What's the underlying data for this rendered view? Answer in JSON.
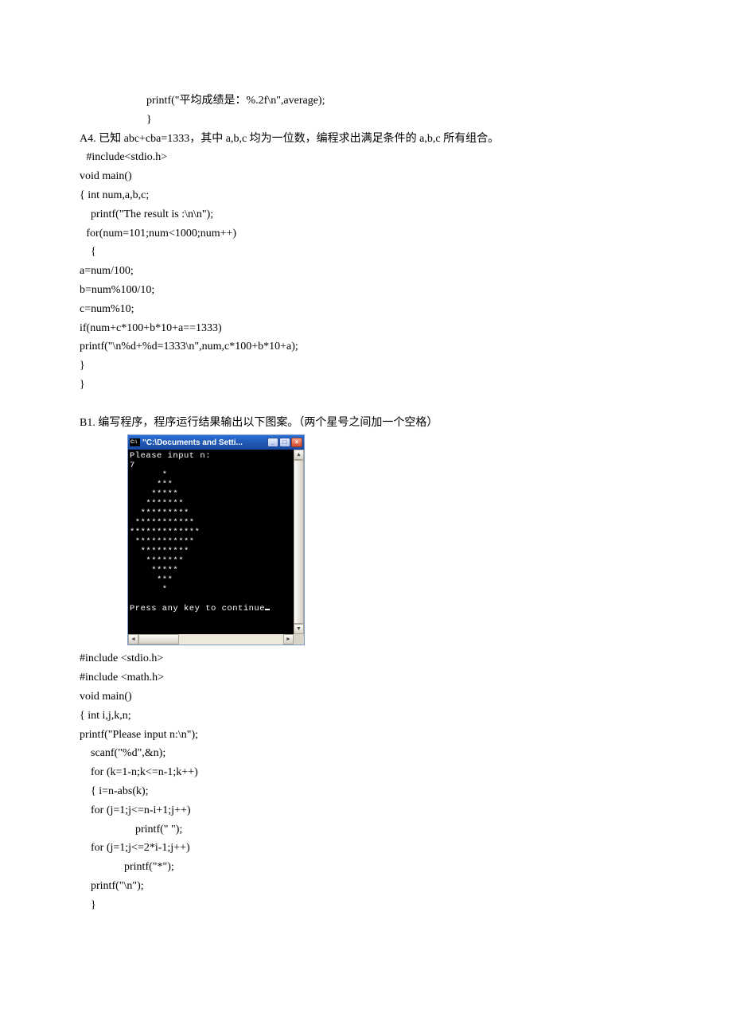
{
  "sec0": {
    "l1": "printf(\"平均成绩是：%.2f\\n\",average);",
    "l2": "}"
  },
  "a4": {
    "title": "A4.  已知 abc+cba=1333，其中 a,b,c 均为一位数，编程求出满足条件的 a,b,c 所有组合。",
    "l1": "#include<stdio.h>",
    "l2": "void main()",
    "l3": "{    int num,a,b,c;",
    "l4": "printf(\"The result is :\\n\\n\");",
    "l5": "for(num=101;num<1000;num++)",
    "l6": "{",
    "l7": "a=num/100;",
    "l8": "b=num%100/10;",
    "l9": "c=num%10;",
    "l10": "if(num+c*100+b*10+a==1333)",
    "l11": "printf(\"\\n%d+%d=1333\\n\",num,c*100+b*10+a);",
    "l12": "}",
    "l13": "}"
  },
  "b1": {
    "title": "B1.  编写程序，程序运行结果输出以下图案。（两个星号之间加一个空格）",
    "console": {
      "win_title": "\"C:\\Documents and Setti...",
      "output": "Please input n:\n7\n      *\n     ***\n    *****\n   *******\n  *********\n ***********\n*************\n ***********\n  *********\n   *******\n    *****\n     ***\n      *\n\nPress any key to continue"
    },
    "code": {
      "l1": "#include <stdio.h>",
      "l2": "#include <math.h>",
      "l3": "void main()",
      "l4": "{ int i,j,k,n;",
      "l5": "printf(\"Please input n:\\n\");",
      "l6": "scanf(\"%d\",&n);",
      "l7": "for (k=1-n;k<=n-1;k++)",
      "l8": "{     i=n-abs(k);",
      "l9": "for (j=1;j<=n-i+1;j++)",
      "l10": "printf(\" \");",
      "l11": "for (j=1;j<=2*i-1;j++)",
      "l12": "printf(\"*\");",
      "l13": "printf(\"\\n\");",
      "l14": "}"
    }
  }
}
